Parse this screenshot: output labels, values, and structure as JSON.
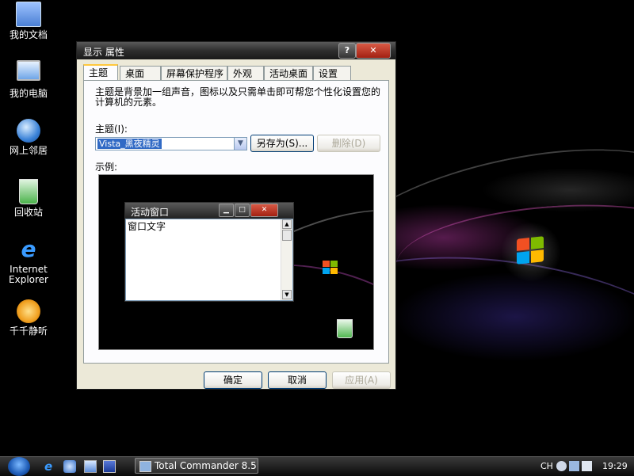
{
  "desktop": {
    "icons": [
      {
        "label": "我的文档",
        "icon": "my-documents-icon"
      },
      {
        "label": "我的电脑",
        "icon": "my-computer-icon"
      },
      {
        "label": "网上邻居",
        "icon": "network-places-icon"
      },
      {
        "label": "回收站",
        "icon": "recycle-bin-icon"
      },
      {
        "label": "Internet Explorer",
        "icon": "internet-explorer-icon"
      },
      {
        "label": "千千静听",
        "icon": "ttplayer-icon"
      }
    ]
  },
  "dialog": {
    "title": "显示 属性",
    "help_glyph": "?",
    "close_glyph": "✕",
    "tabs": [
      {
        "label": "主题",
        "active": true
      },
      {
        "label": "桌面",
        "active": false
      },
      {
        "label": "屏幕保护程序",
        "active": false
      },
      {
        "label": "外观",
        "active": false
      },
      {
        "label": "活动桌面",
        "active": false
      },
      {
        "label": "设置",
        "active": false
      }
    ],
    "description": "主题是背景加一组声音，图标以及只需单击即可帮您个性化设置您的计算机的元素。",
    "theme_label": "主题(I):",
    "theme_value": "Vista_黑夜精灵",
    "saveas_label": "另存为(S)...",
    "delete_label": "删除(D)",
    "preview_label": "示例:",
    "preview": {
      "window_title": "活动窗口",
      "window_text": "窗口文字"
    },
    "ok_label": "确定",
    "cancel_label": "取消",
    "apply_label": "应用(A)"
  },
  "taskbar": {
    "task_label": "Total Commander 8.5...",
    "language": "CH",
    "clock": "19:29"
  }
}
